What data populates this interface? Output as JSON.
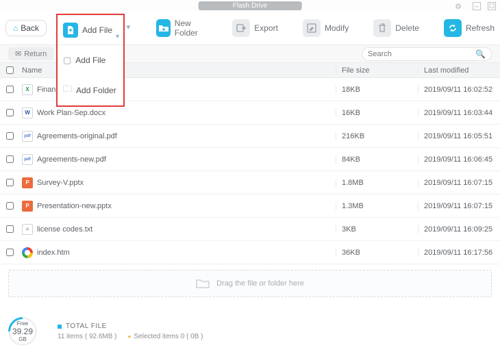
{
  "window": {
    "title": "Flash Drive"
  },
  "toolbar": {
    "back": "Back",
    "add_file": "Add File",
    "new_folder": "New Folder",
    "export": "Export",
    "modify": "Modify",
    "delete": "Delete",
    "refresh": "Refresh"
  },
  "dropdown": {
    "add_file": "Add File",
    "add_folder": "Add Folder"
  },
  "return_bar": {
    "label": "Return"
  },
  "search": {
    "placeholder": "Search"
  },
  "columns": {
    "name": "Name",
    "size": "File size",
    "date": "Last modified"
  },
  "files": [
    {
      "type": "xlsx",
      "name": "Financial Statements.xlsx",
      "size": "18KB",
      "date": "2019/09/11 16:02:52"
    },
    {
      "type": "docx",
      "name": "Work Plan-Sep.docx",
      "size": "16KB",
      "date": "2019/09/11 16:03:44"
    },
    {
      "type": "pdf",
      "name": "Agreements-original.pdf",
      "size": "216KB",
      "date": "2019/09/11 16:05:51"
    },
    {
      "type": "pdf",
      "name": "Agreements-new.pdf",
      "size": "84KB",
      "date": "2019/09/11 16:06:45"
    },
    {
      "type": "pptx",
      "name": "Survey-V.pptx",
      "size": "1.8MB",
      "date": "2019/09/11 16:07:15"
    },
    {
      "type": "pptx",
      "name": "Presentation-new.pptx",
      "size": "1.3MB",
      "date": "2019/09/11 16:07:15"
    },
    {
      "type": "txt",
      "name": "license codes.txt",
      "size": "3KB",
      "date": "2019/09/11 16:09:25"
    },
    {
      "type": "htm",
      "name": "index.htm",
      "size": "36KB",
      "date": "2019/09/11 16:17:56"
    }
  ],
  "dropzone": {
    "text": "Drag the file or folder here"
  },
  "footer": {
    "free_label": "Free",
    "free_value": "39.29",
    "free_unit": "GB",
    "total_label": "TOTAL FILE",
    "items": "11 items ( 92.6MB )",
    "selected": "Selected items 0 ( 0B )"
  }
}
